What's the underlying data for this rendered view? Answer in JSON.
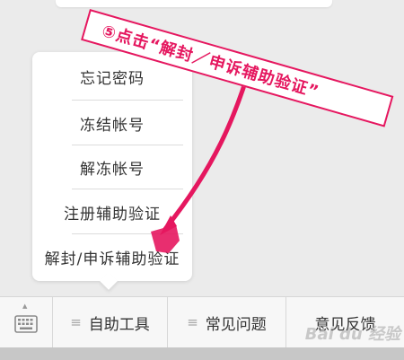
{
  "annotation": {
    "banner_text": "⑤点击“解封／申诉辅助验证”",
    "color": "#e5175f"
  },
  "menu": {
    "items": [
      {
        "label": "忘记密码"
      },
      {
        "label": "冻结帐号"
      },
      {
        "label": "解冻帐号"
      },
      {
        "label": "注册辅助验证"
      },
      {
        "label": "解封/申诉辅助验证"
      }
    ]
  },
  "bottombar": {
    "keyboard_icon": "keyboard-icon",
    "tabs": [
      {
        "label": "自助工具",
        "icon": "menu-icon"
      },
      {
        "label": "常见问题",
        "icon": "menu-icon"
      },
      {
        "label": "意见反馈"
      }
    ]
  },
  "watermark": {
    "text": "Bai du 经验"
  }
}
